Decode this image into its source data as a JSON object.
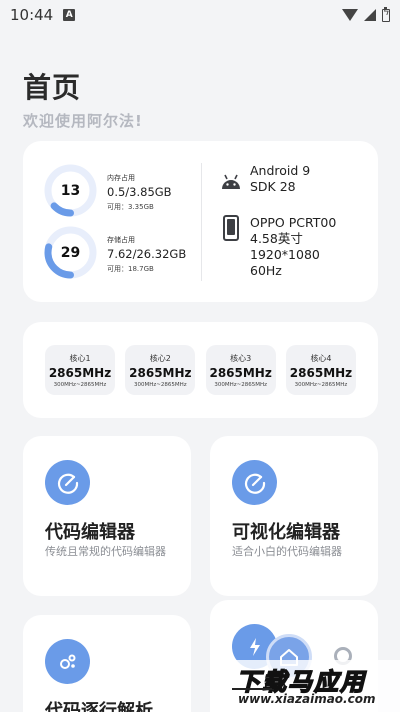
{
  "statusbar": {
    "time": "10:44",
    "notification_icon": "A"
  },
  "header": {
    "title": "首页",
    "subtitle": "欢迎使用阿尔法!"
  },
  "device": {
    "memory": {
      "percent": 13,
      "label": "内存占用",
      "used_total": "0.5/3.85GB",
      "available": "可用：3.35GB"
    },
    "storage": {
      "percent": 29,
      "label": "存储占用",
      "used_total": "7.62/26.32GB",
      "available": "可用：18.7GB"
    },
    "os": {
      "name": "Android 9",
      "sdk": "SDK 28"
    },
    "model": {
      "name": "OPPO PCRT00",
      "size": "4.58英寸",
      "resolution": "1920*1080",
      "refresh": "60Hz"
    }
  },
  "cpu": {
    "cores": [
      {
        "name": "核心1",
        "freq": "2865MHz",
        "range": "300MHz~2865MHz"
      },
      {
        "name": "核心2",
        "freq": "2865MHz",
        "range": "300MHz~2865MHz"
      },
      {
        "name": "核心3",
        "freq": "2865MHz",
        "range": "300MHz~2865MHz"
      },
      {
        "name": "核心4",
        "freq": "2865MHz",
        "range": "300MHz~2865MHz"
      }
    ]
  },
  "features": [
    {
      "title": "代码编辑器",
      "desc": "传统且常规的代码编辑器",
      "icon": "edit-icon"
    },
    {
      "title": "可视化编辑器",
      "desc": "适合小白的代码编辑器",
      "icon": "edit-icon"
    },
    {
      "title": "代码逐行解析",
      "desc": "",
      "icon": "molecule-icon"
    },
    {
      "title": "",
      "desc": "",
      "icon": "bolt-icon"
    }
  ],
  "watermark": {
    "title": "下载马应用",
    "url": "www.xiazaimao.com"
  },
  "colors": {
    "accent": "#6a9be8",
    "ring_track": "#e8eefb",
    "background": "#f3f4f6",
    "card": "#ffffff"
  }
}
